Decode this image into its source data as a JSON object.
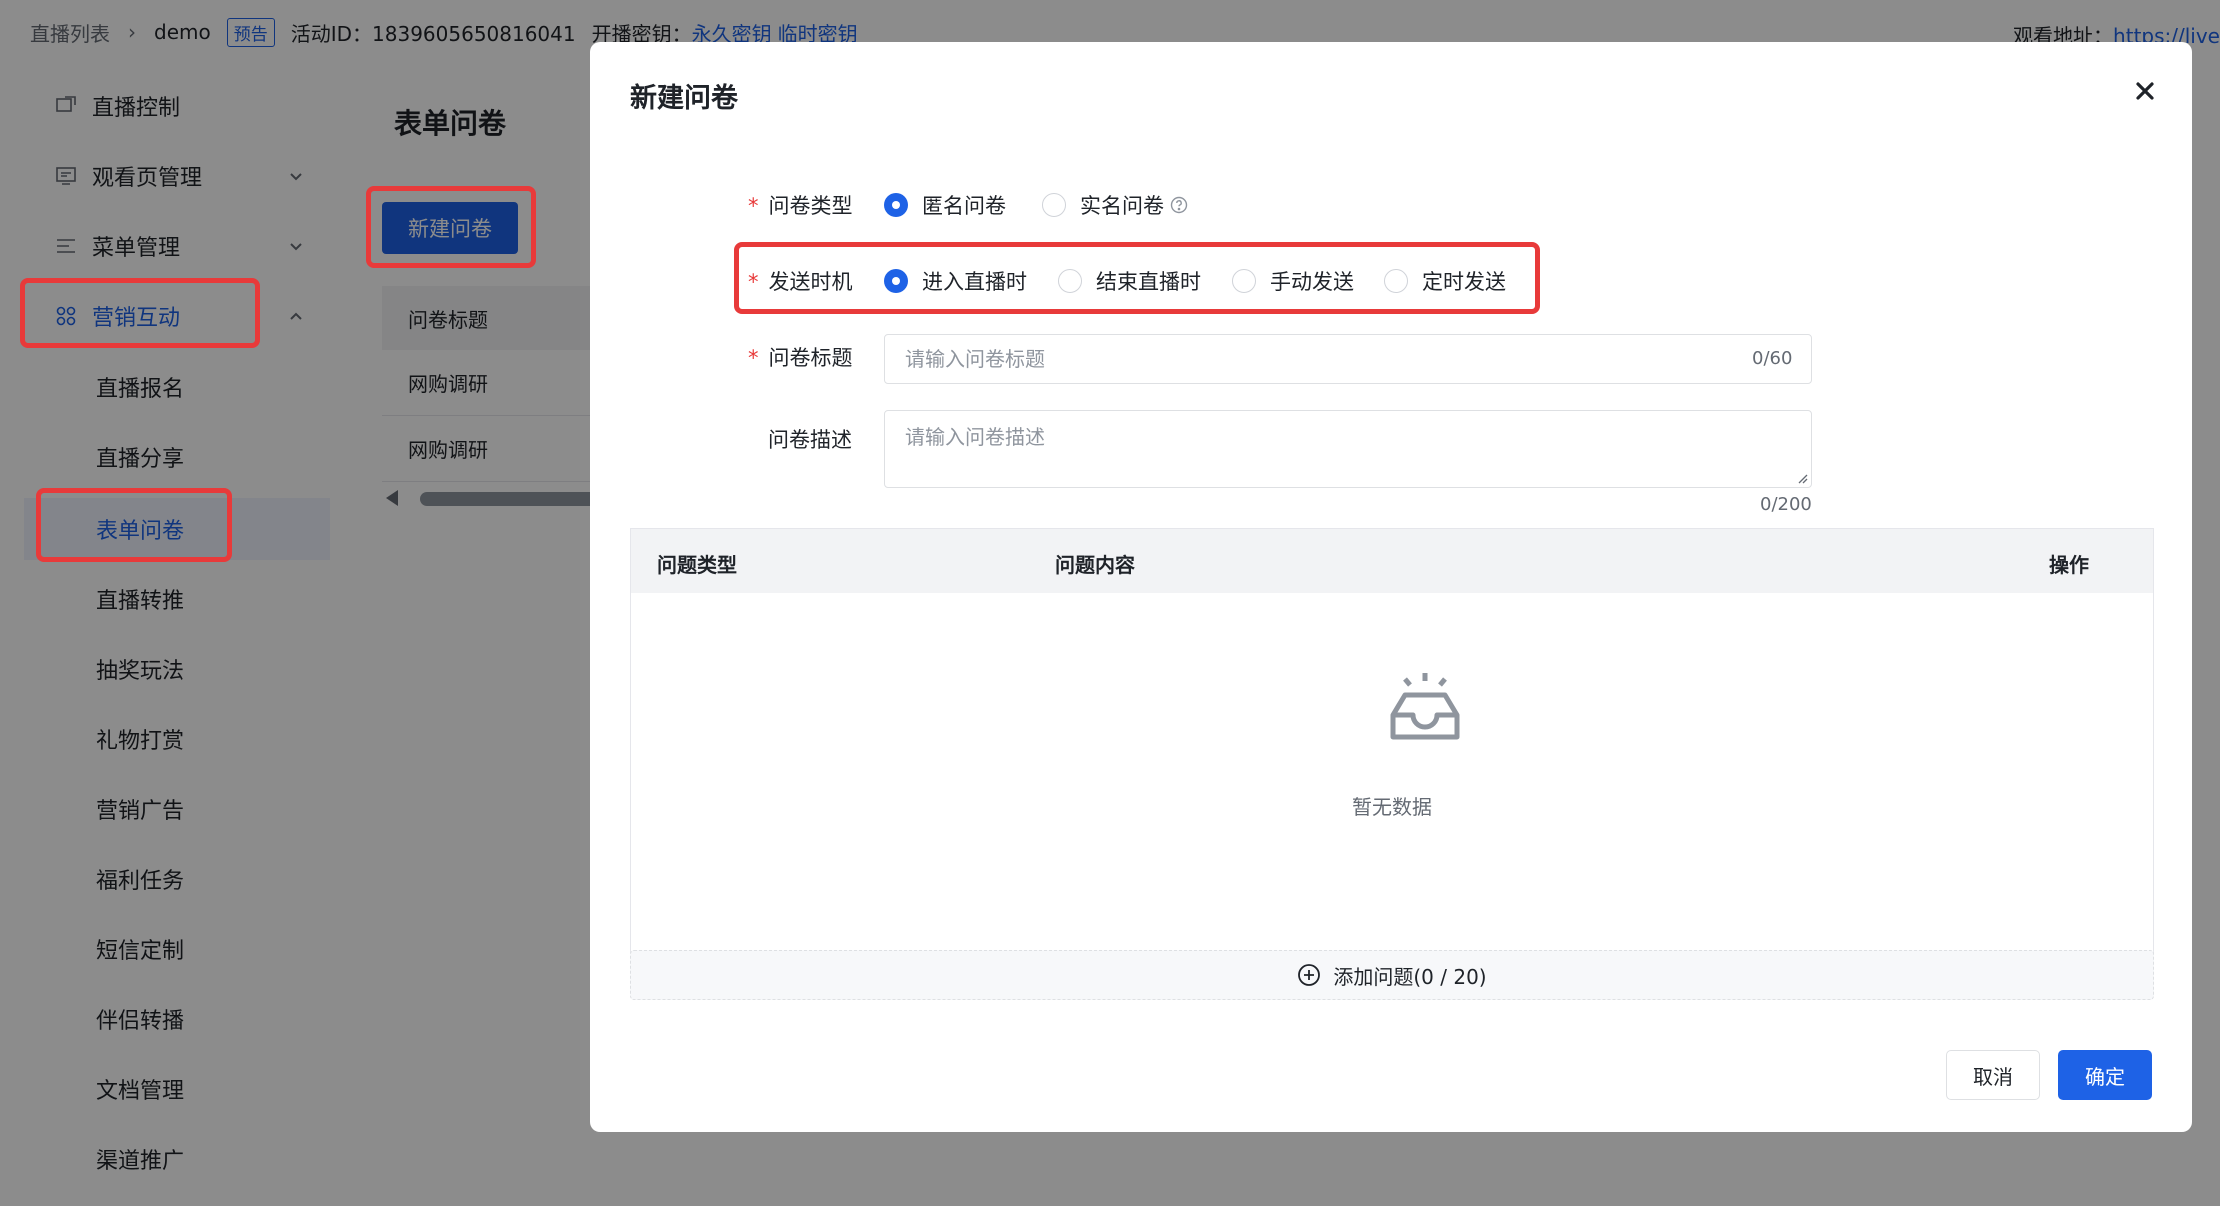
{
  "topbar": {
    "breadcrumb_root": "直播列表",
    "breadcrumb_current": "demo",
    "status_badge": "预告",
    "activity_id_label": "活动ID：1839605650816041",
    "stream_key_label": "开播密钥：",
    "stream_key_permanent": "永久密钥",
    "stream_key_temp": "临时密钥",
    "watch_url_label": "观看地址：",
    "watch_url": "https://live"
  },
  "sidebar": {
    "items": [
      {
        "label": "直播控制",
        "icon": "monitor-icon"
      },
      {
        "label": "观看页管理",
        "icon": "display-icon"
      },
      {
        "label": "菜单管理",
        "icon": "list-icon"
      },
      {
        "label": "营销互动",
        "icon": "grid-icon"
      }
    ],
    "sub_items": [
      "直播报名",
      "直播分享",
      "表单问卷",
      "直播转推",
      "抽奖玩法",
      "礼物打赏",
      "营销广告",
      "福利任务",
      "短信定制",
      "伴侣转播",
      "文档管理",
      "渠道推广"
    ]
  },
  "main": {
    "page_title": "表单问卷",
    "create_button": "新建问卷",
    "table_header": "问卷标题",
    "rows": [
      "网购调研",
      "网购调研"
    ]
  },
  "modal": {
    "title": "新建问卷",
    "type_label": "问卷类型",
    "type_options": [
      "匿名问卷",
      "实名问卷"
    ],
    "type_selected": "匿名问卷",
    "timing_label": "发送时机",
    "timing_options": [
      "进入直播时",
      "结束直播时",
      "手动发送",
      "定时发送"
    ],
    "timing_selected": "进入直播时",
    "title_label": "问卷标题",
    "title_placeholder": "请输入问卷标题",
    "title_counter": "0/60",
    "desc_label": "问卷描述",
    "desc_placeholder": "请输入问卷描述",
    "desc_counter": "0/200",
    "table_headers": [
      "问题类型",
      "问题内容",
      "操作"
    ],
    "empty_text": "暂无数据",
    "add_button": "添加问题(0 / 20)",
    "cancel_button": "取消",
    "confirm_button": "确定"
  },
  "colors": {
    "primary": "#1e62e6",
    "highlight": "#e83a3a",
    "required": "#e83a3a"
  }
}
